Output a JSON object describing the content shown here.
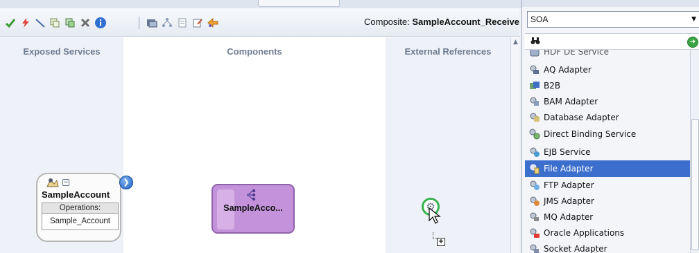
{
  "toolbar": {
    "composite_prefix": "Composite:",
    "composite_name": "SampleAccount_Receive",
    "icons": [
      "validate-check-icon",
      "deploy-lightning-icon",
      "wire-icon",
      "add-icon",
      "copy-icon",
      "delete-icon",
      "info-icon",
      "test-icon",
      "tree-icon",
      "pages-icon",
      "edit-icon",
      "flow-icon"
    ]
  },
  "lanes": {
    "exposed_services": "Exposed Services",
    "components": "Components",
    "external_references": "External References"
  },
  "service": {
    "name": "SampleAccount",
    "operations_label": "Operations:",
    "operation": "Sample_Account"
  },
  "component": {
    "name": "SampleAcco..."
  },
  "palette": {
    "selected_category": "SOA",
    "items": [
      {
        "label": "HDF DE Service",
        "icon": "adapter-icon"
      },
      {
        "label": "AQ Adapter",
        "icon": "aq-adapter-icon"
      },
      {
        "label": "B2B",
        "icon": "b2b-icon"
      },
      {
        "label": "BAM Adapter",
        "icon": "bam-adapter-icon"
      },
      {
        "label": "Database Adapter",
        "icon": "database-adapter-icon"
      },
      {
        "label": "Direct Binding Service",
        "icon": "direct-binding-icon"
      },
      {
        "label": "EJB Service",
        "icon": "ejb-service-icon"
      },
      {
        "label": "File Adapter",
        "icon": "file-adapter-icon"
      },
      {
        "label": "FTP Adapter",
        "icon": "ftp-adapter-icon"
      },
      {
        "label": "JMS Adapter",
        "icon": "jms-adapter-icon"
      },
      {
        "label": "MQ Adapter",
        "icon": "mq-adapter-icon"
      },
      {
        "label": "Oracle Applications",
        "icon": "oracle-apps-icon"
      },
      {
        "label": "Socket Adapter",
        "icon": "socket-adapter-icon"
      }
    ]
  },
  "colors": {
    "selection": "#3c6fcd",
    "component_fill": "#c492da",
    "drag_ring": "#36b34a"
  }
}
